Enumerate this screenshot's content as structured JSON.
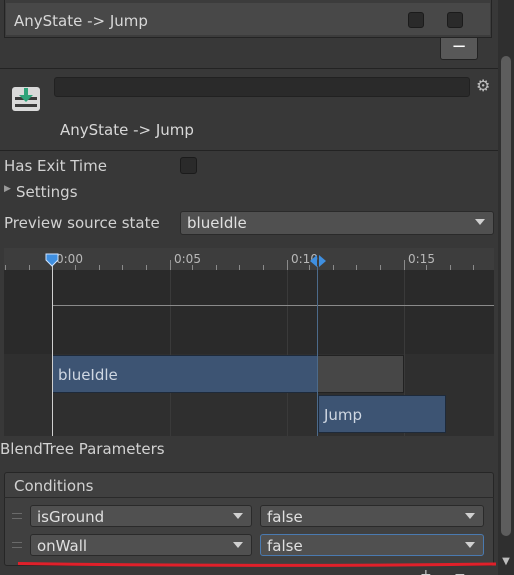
{
  "transitions_list": {
    "row_label": "AnyState -> Jump",
    "remove_button": "−"
  },
  "header": {
    "title": "AnyState -> Jump",
    "name_value": ""
  },
  "settings": {
    "has_exit_time_label": "Has Exit Time",
    "has_exit_time_checked": false,
    "settings_label": "Settings",
    "preview_source_label": "Preview source state",
    "preview_source_value": "blueIdle"
  },
  "timeline": {
    "tick_labels": [
      "0:00",
      "0:05",
      "0:10",
      "0:15"
    ],
    "source_state": "blueIdle",
    "destination_state": "Jump"
  },
  "blendtree_label": "BlendTree Parameters",
  "conditions": {
    "header": "Conditions",
    "rows": [
      {
        "parameter": "isGround",
        "value": "false"
      },
      {
        "parameter": "onWall",
        "value": "false"
      }
    ],
    "add_button": "+",
    "remove_button": "−"
  },
  "colors": {
    "panel_bg": "#383838",
    "state_bar": "#3d5473",
    "annotation_red": "#e0202a"
  }
}
